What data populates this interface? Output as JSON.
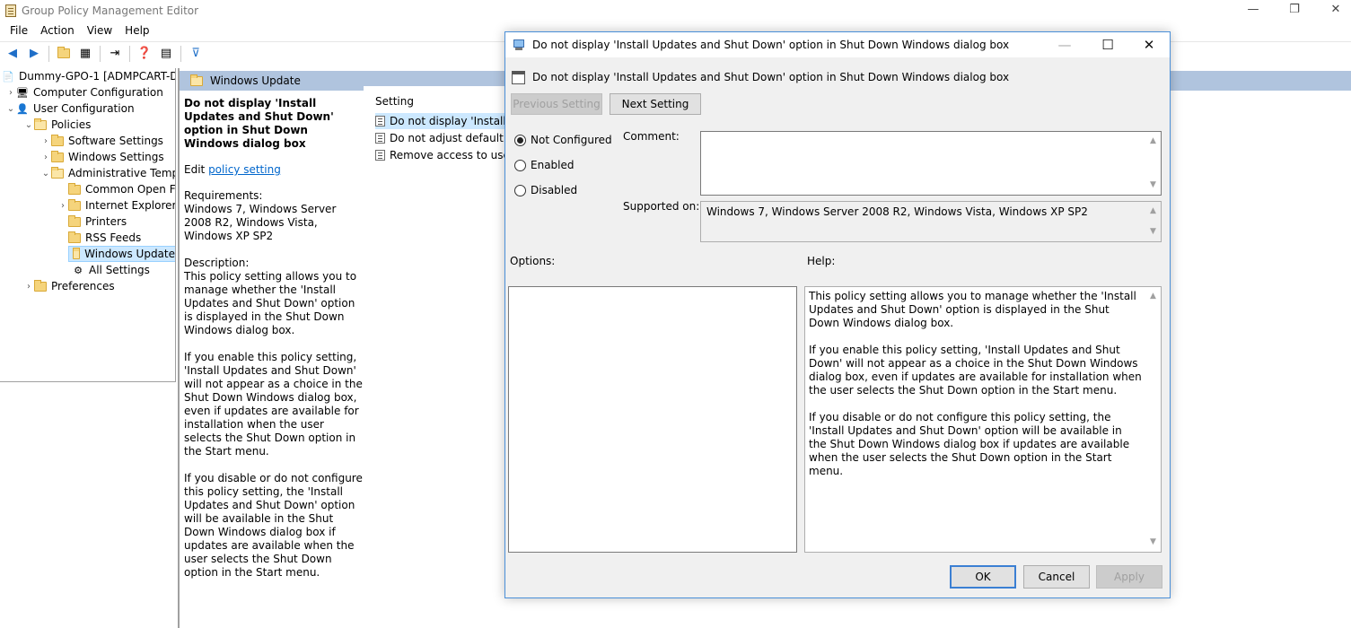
{
  "window": {
    "title": "Group Policy Management Editor",
    "controls": {
      "minimize": "—",
      "restore": "❐",
      "close": "✕"
    }
  },
  "menu": [
    "File",
    "Action",
    "View",
    "Help"
  ],
  "tree": {
    "items": [
      {
        "label": "Dummy-GPO-1 [ADMPCART-D",
        "chev": "",
        "icon": "gpo-icon"
      },
      {
        "label": "Computer Configuration",
        "chev": "›",
        "icon": "computer-icon"
      },
      {
        "label": "User Configuration",
        "chev": "⌄",
        "icon": "user-icon"
      },
      {
        "label": "Policies",
        "chev": "⌄",
        "icon": "folder-icon"
      },
      {
        "label": "Software Settings",
        "chev": "›",
        "icon": "folder-icon"
      },
      {
        "label": "Windows Settings",
        "chev": "›",
        "icon": "folder-icon"
      },
      {
        "label": "Administrative Temp",
        "chev": "⌄",
        "icon": "folder-icon"
      },
      {
        "label": "Common Open F",
        "chev": "",
        "icon": "folder-icon"
      },
      {
        "label": "Internet Explorer",
        "chev": "›",
        "icon": "folder-icon"
      },
      {
        "label": "Printers",
        "chev": "",
        "icon": "folder-icon"
      },
      {
        "label": "RSS Feeds",
        "chev": "",
        "icon": "folder-icon"
      },
      {
        "label": "Windows Update",
        "chev": "",
        "icon": "folder-icon"
      },
      {
        "label": "All Settings",
        "chev": "",
        "icon": "all-settings-icon"
      },
      {
        "label": "Preferences",
        "chev": "›",
        "icon": "folder-icon"
      }
    ]
  },
  "section": {
    "title": "Windows Update"
  },
  "description": {
    "title": "Do not display 'Install Updates and Shut Down' option in Shut Down Windows dialog box",
    "edit_prefix": "Edit ",
    "edit_link": "policy setting",
    "requirements": "Requirements:\nWindows 7, Windows Server 2008 R2, Windows Vista, Windows XP SP2",
    "desc": "Description:\nThis policy setting allows you to manage whether the 'Install Updates and Shut Down' option is displayed in the Shut Down Windows dialog box.",
    "enable": "If you enable this policy setting, 'Install Updates and Shut Down' will not appear as a choice in the Shut Down Windows dialog box, even if updates are available for installation when the user selects the Shut Down option in the Start menu.",
    "disable": "If you disable or do not configure this policy setting, the 'Install Updates and Shut Down' option will be available in the Shut Down Windows dialog box if updates are available when the user selects the Shut Down option in the Start menu."
  },
  "settings": {
    "header": "Setting",
    "rows": [
      "Do not display 'Install Up",
      "Do not adjust default op",
      "Remove access to use al"
    ]
  },
  "dialog": {
    "title": "Do not display 'Install Updates and Shut Down' option in Shut Down Windows dialog box",
    "header": "Do not display 'Install Updates and Shut Down' option in Shut Down Windows dialog box",
    "prev": "Previous Setting",
    "next": "Next Setting",
    "radios": [
      "Not Configured",
      "Enabled",
      "Disabled"
    ],
    "selected_radio": "Not Configured",
    "comment_label": "Comment:",
    "comment_value": "",
    "supported_label": "Supported on:",
    "supported_value": "Windows 7, Windows Server 2008 R2, Windows Vista, Windows XP SP2",
    "options_label": "Options:",
    "help_label": "Help:",
    "help_text": "This policy setting allows you to manage whether the 'Install Updates and Shut Down' option is displayed in the Shut Down Windows dialog box.\n\nIf you enable this policy setting, 'Install Updates and Shut Down' will not appear as a choice in the Shut Down Windows dialog box, even if updates are available for installation when the user selects the Shut Down option in the Start menu.\n\nIf you disable or do not configure this policy setting, the 'Install Updates and Shut Down' option will be available in the Shut Down Windows dialog box if updates are available when the user selects the Shut Down option in the Start menu.",
    "ok": "OK",
    "cancel": "Cancel",
    "apply": "Apply",
    "controls": {
      "minimize": "—",
      "maximize": "☐",
      "close": "✕"
    }
  },
  "colors": {
    "selection": "#cce8ff",
    "section_header": "#b0c4de",
    "dialog_bg": "#f0f0f0",
    "link": "#0066cc"
  }
}
